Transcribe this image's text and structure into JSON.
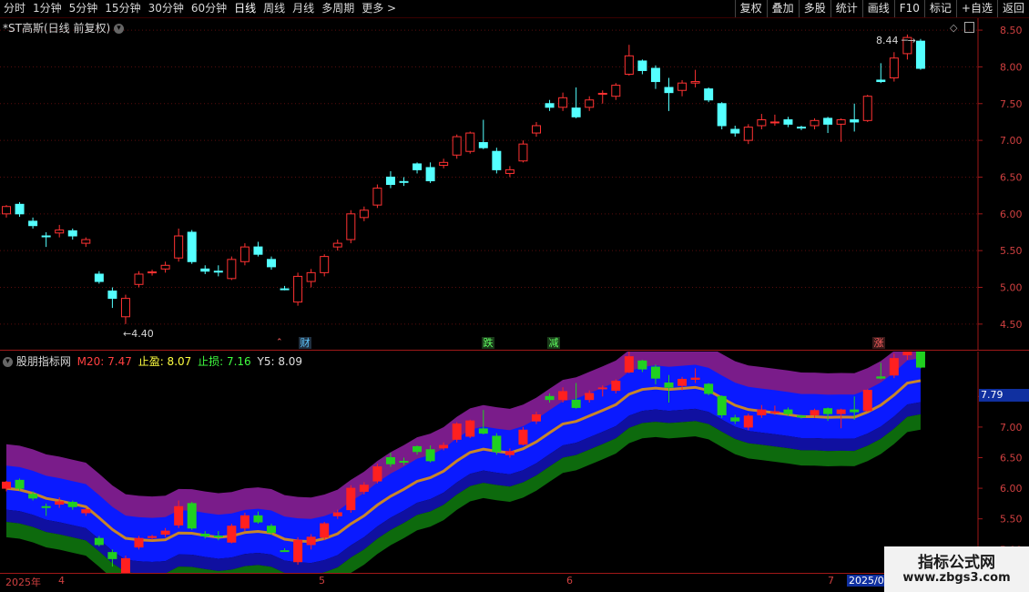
{
  "toolbar": {
    "periods": [
      "分时",
      "1分钟",
      "5分钟",
      "15分钟",
      "30分钟",
      "60分钟",
      "日线",
      "周线",
      "月线",
      "多周期",
      "更多 >"
    ],
    "active_period": "日线",
    "buttons": [
      "复权",
      "叠加",
      "多股",
      "统计",
      "画线",
      "F10",
      "标记",
      "+自选",
      "返回"
    ]
  },
  "main_panel": {
    "title": "*ST高斯(日线 前复权)",
    "price_axis": [
      "8.50",
      "8.00",
      "7.50",
      "7.00",
      "6.50",
      "6.00",
      "5.50",
      "5.00",
      "4.50"
    ],
    "high_label": "8.44",
    "low_label": "4.40",
    "event_markers": [
      "财",
      "跌",
      "减",
      "涨"
    ]
  },
  "indicator_panel": {
    "name": "股朋指标网",
    "m20_label": "M20: 7.47",
    "stop_profit_label": "止盈: 8.07",
    "stop_loss_label": "止损: 7.16",
    "y5_label": "Y5: 8.09",
    "price_axis": [
      "7.50",
      "7.00",
      "6.50",
      "6.00",
      "5.50",
      "5.00"
    ],
    "current_price_tag": "7.79"
  },
  "date_axis": [
    "2025年",
    "4",
    "5",
    "6",
    "7",
    "2025/0"
  ],
  "watermark": {
    "title": "指标公式网",
    "url": "www.zbgs3.com"
  },
  "colors": {
    "up": "#ff3232",
    "down": "#54ffff",
    "purple": "#7a1c8a",
    "blue": "#0a1aff",
    "navy": "#1010a0",
    "green": "#0d6a0d",
    "orange": "#c8852a"
  },
  "chart_data": {
    "type": "candlestick",
    "y_range_main": [
      4.3,
      8.6
    ],
    "y_range_indicator": [
      4.9,
      8.1
    ],
    "candles": [
      [
        6.0,
        6.1,
        6.12,
        5.95
      ],
      [
        6.13,
        6.0,
        6.16,
        5.96
      ],
      [
        5.9,
        5.84,
        5.95,
        5.8
      ],
      [
        5.7,
        5.69,
        5.75,
        5.55
      ],
      [
        5.74,
        5.78,
        5.85,
        5.68
      ],
      [
        5.77,
        5.7,
        5.8,
        5.65
      ],
      [
        5.6,
        5.65,
        5.68,
        5.55
      ],
      [
        5.18,
        5.08,
        5.22,
        5.05
      ],
      [
        4.95,
        4.85,
        5.0,
        4.72
      ],
      [
        4.6,
        4.85,
        4.9,
        4.5
      ],
      [
        5.04,
        5.18,
        5.22,
        5.0
      ],
      [
        5.2,
        5.21,
        5.24,
        5.16
      ],
      [
        5.25,
        5.3,
        5.35,
        5.2
      ],
      [
        5.4,
        5.7,
        5.8,
        5.35
      ],
      [
        5.75,
        5.35,
        5.78,
        5.32
      ],
      [
        5.25,
        5.22,
        5.3,
        5.18
      ],
      [
        5.22,
        5.21,
        5.3,
        5.15
      ],
      [
        5.12,
        5.38,
        5.42,
        5.1
      ],
      [
        5.35,
        5.55,
        5.6,
        5.3
      ],
      [
        5.55,
        5.45,
        5.62,
        5.42
      ],
      [
        5.38,
        5.28,
        5.42,
        5.24
      ],
      [
        4.98,
        4.97,
        5.02,
        4.96
      ],
      [
        4.8,
        5.15,
        5.2,
        4.75
      ],
      [
        5.08,
        5.2,
        5.25,
        5.0
      ],
      [
        5.2,
        5.42,
        5.45,
        5.15
      ],
      [
        5.55,
        5.6,
        5.65,
        5.5
      ],
      [
        5.65,
        6.0,
        6.05,
        5.6
      ],
      [
        5.95,
        6.05,
        6.1,
        5.9
      ],
      [
        6.12,
        6.35,
        6.4,
        6.08
      ],
      [
        6.5,
        6.4,
        6.58,
        6.35
      ],
      [
        6.44,
        6.43,
        6.5,
        6.38
      ],
      [
        6.68,
        6.6,
        6.7,
        6.55
      ],
      [
        6.63,
        6.45,
        6.7,
        6.42
      ],
      [
        6.66,
        6.7,
        6.75,
        6.62
      ],
      [
        6.8,
        7.05,
        7.08,
        6.75
      ],
      [
        6.85,
        7.1,
        7.12,
        6.82
      ],
      [
        6.97,
        6.9,
        7.28,
        6.88
      ],
      [
        6.85,
        6.6,
        6.9,
        6.55
      ],
      [
        6.55,
        6.6,
        6.65,
        6.5
      ],
      [
        6.72,
        6.95,
        7.0,
        6.7
      ],
      [
        7.1,
        7.2,
        7.25,
        7.05
      ],
      [
        7.5,
        7.45,
        7.55,
        7.4
      ],
      [
        7.45,
        7.58,
        7.65,
        7.4
      ],
      [
        7.44,
        7.32,
        7.72,
        7.3
      ],
      [
        7.45,
        7.55,
        7.6,
        7.4
      ],
      [
        7.63,
        7.64,
        7.68,
        7.5
      ],
      [
        7.6,
        7.75,
        7.78,
        7.55
      ],
      [
        7.9,
        8.15,
        8.3,
        7.88
      ],
      [
        8.08,
        7.95,
        8.1,
        7.9
      ],
      [
        7.98,
        7.8,
        8.02,
        7.7
      ],
      [
        7.72,
        7.65,
        7.85,
        7.4
      ],
      [
        7.68,
        7.78,
        7.82,
        7.6
      ],
      [
        7.78,
        7.8,
        7.96,
        7.72
      ],
      [
        7.7,
        7.55,
        7.72,
        7.52
      ],
      [
        7.5,
        7.2,
        7.52,
        7.15
      ],
      [
        7.15,
        7.1,
        7.2,
        7.05
      ],
      [
        7.0,
        7.18,
        7.22,
        6.95
      ],
      [
        7.2,
        7.28,
        7.36,
        7.15
      ],
      [
        7.24,
        7.25,
        7.35,
        7.2
      ],
      [
        7.28,
        7.22,
        7.32,
        7.18
      ],
      [
        7.18,
        7.17,
        7.2,
        7.14
      ],
      [
        7.2,
        7.27,
        7.3,
        7.15
      ],
      [
        7.3,
        7.22,
        7.32,
        7.1
      ],
      [
        7.22,
        7.28,
        7.3,
        6.98
      ],
      [
        7.28,
        7.25,
        7.5,
        7.12
      ],
      [
        7.27,
        7.6,
        7.62,
        7.25
      ],
      [
        7.82,
        7.8,
        8.05,
        7.78
      ],
      [
        7.85,
        8.12,
        8.2,
        7.8
      ],
      [
        8.18,
        8.4,
        8.44,
        8.1
      ],
      [
        8.35,
        7.98,
        8.38,
        7.96
      ]
    ]
  }
}
